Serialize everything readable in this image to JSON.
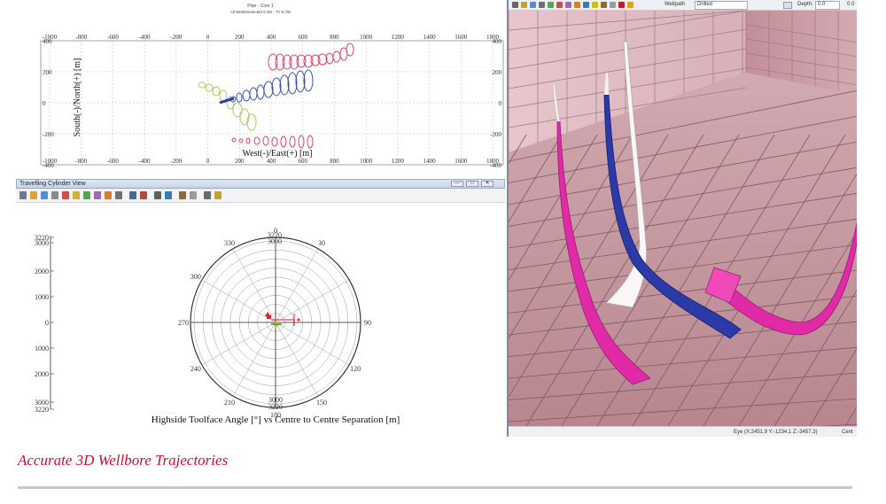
{
  "plan_view": {
    "window_title": "Plan - Core 1",
    "window_subtitle": "All Wells/Selected 6 /60 : 70 % fits",
    "x_ticks": [
      "-1000",
      "-800",
      "-600",
      "-400",
      "-200",
      "0",
      "200",
      "400",
      "600",
      "800",
      "1000",
      "1200",
      "1400",
      "1600",
      "1800"
    ],
    "y_ticks_left": [
      "400",
      "200",
      "0",
      "-200",
      "-400"
    ],
    "y_ticks_right": [
      "400",
      "200",
      "0",
      "-200",
      "-400"
    ],
    "x_axis_label": "West(-)/East(+) [m]",
    "y_axis_label": "South(-)/North(+) [m]"
  },
  "cylinder_window": {
    "title": "Travelling Cylinder View",
    "buttons": [
      "—",
      "□",
      "✕"
    ]
  },
  "polar_plot": {
    "radial_ticks_top": [
      "3220",
      "3000",
      "2000",
      "1000",
      "0",
      "1000",
      "2000",
      "3000",
      "3220"
    ],
    "angle_labels": [
      "0",
      "30",
      "90",
      "120",
      "150",
      "180",
      "210",
      "240",
      "270",
      "300",
      "330"
    ],
    "bottom_labels": [
      "3000",
      "3220"
    ],
    "axis_label": "Highside Toolface Angle [°] vs Centre to Centre Separation [m]"
  },
  "view3d": {
    "toolbar_label": "Wellpath",
    "toolbar_field": "Drilled",
    "depth_label": "Depth:",
    "depth_value": "0.0",
    "depth_value2": "0.0",
    "status_text": "Eye (X:2451.9 Y:-1234.1 Z:-3457.3)",
    "status_right": "Cent"
  },
  "caption": "Accurate 3D Wellbore Trajectories",
  "colors": {
    "caption": "#c8102e",
    "magenta": "#e02aa6",
    "blue": "#2b3aa6",
    "floor": "#c49aa2"
  }
}
